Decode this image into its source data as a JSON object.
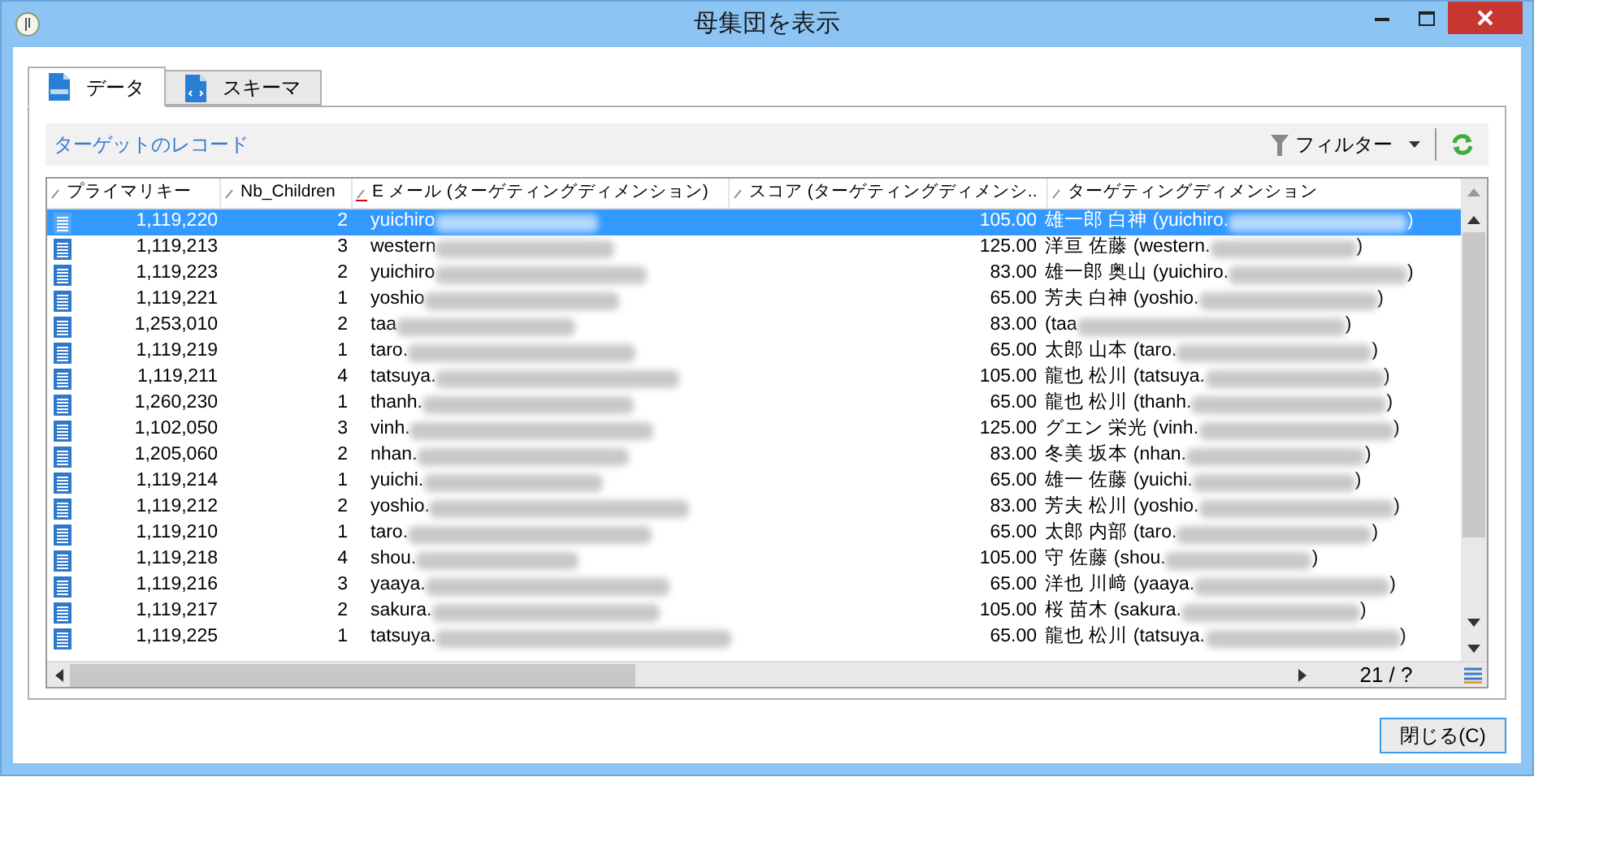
{
  "window": {
    "title": "母集団を表示"
  },
  "tabs": [
    {
      "label": "データ",
      "selected": true,
      "kind": "sql"
    },
    {
      "label": "スキーマ",
      "selected": false,
      "kind": "schema"
    }
  ],
  "toolbar": {
    "title": "ターゲットのレコード",
    "filter": "フィルター"
  },
  "table": {
    "columns": [
      {
        "label": "プライマリキー",
        "sorted": false
      },
      {
        "label": "Nb_Children",
        "sorted": false
      },
      {
        "label": "E メール (ターゲティングディメンション)",
        "sorted": true
      },
      {
        "label": "スコア (ターゲティングディメンシ..",
        "sorted": false
      },
      {
        "label": "ターゲティングディメンション",
        "sorted": false
      }
    ],
    "rows": [
      {
        "selected": true,
        "key": "1,119,220",
        "children": "2",
        "email": "yuichiro",
        "score": "105.00",
        "target": "雄一郎 白神 (yuichiro.",
        "close": ")"
      },
      {
        "selected": false,
        "key": "1,119,213",
        "children": "3",
        "email": "western",
        "score": "125.00",
        "target": "洋亘 佐藤 (western.",
        "close": ")"
      },
      {
        "selected": false,
        "key": "1,119,223",
        "children": "2",
        "email": "yuichiro",
        "score": "83.00",
        "target": "雄一郎 奥山 (yuichiro.",
        "close": ")"
      },
      {
        "selected": false,
        "key": "1,119,221",
        "children": "1",
        "email": "yoshio",
        "score": "65.00",
        "target": "芳夫 白神 (yoshio.",
        "close": ")"
      },
      {
        "selected": false,
        "key": "1,253,010",
        "children": "2",
        "email": "taa",
        "score": "83.00",
        "target": "(taa",
        "close": ")"
      },
      {
        "selected": false,
        "key": "1,119,219",
        "children": "1",
        "email": "taro.",
        "score": "65.00",
        "target": "太郎 山本 (taro.",
        "close": ")"
      },
      {
        "selected": false,
        "key": "1,119,211",
        "children": "4",
        "email": "tatsuya.",
        "score": "105.00",
        "target": "龍也 松川 (tatsuya.",
        "close": ")"
      },
      {
        "selected": false,
        "key": "1,260,230",
        "children": "1",
        "email": "thanh.",
        "score": "65.00",
        "target": "龍也 松川 (thanh.",
        "close": ")"
      },
      {
        "selected": false,
        "key": "1,102,050",
        "children": "3",
        "email": "vinh.",
        "score": "125.00",
        "target": "グエン 栄光 (vinh.",
        "close": ")"
      },
      {
        "selected": false,
        "key": "1,205,060",
        "children": "2",
        "email": "nhan.",
        "score": "83.00",
        "target": "冬美 坂本 (nhan.",
        "close": ")"
      },
      {
        "selected": false,
        "key": "1,119,214",
        "children": "1",
        "email": "yuichi.",
        "score": "65.00",
        "target": "雄一 佐藤 (yuichi.",
        "close": ")"
      },
      {
        "selected": false,
        "key": "1,119,212",
        "children": "2",
        "email": "yoshio.",
        "score": "83.00",
        "target": "芳夫 松川 (yoshio.",
        "close": ")"
      },
      {
        "selected": false,
        "key": "1,119,210",
        "children": "1",
        "email": "taro.",
        "score": "65.00",
        "target": "太郎 内部 (taro.",
        "close": ")"
      },
      {
        "selected": false,
        "key": "1,119,218",
        "children": "4",
        "email": "shou.",
        "score": "105.00",
        "target": "守 佐藤 (shou.",
        "close": ")"
      },
      {
        "selected": false,
        "key": "1,119,216",
        "children": "3",
        "email": "yaaya.",
        "score": "65.00",
        "target": "洋也 川﨑 (yaaya.",
        "close": ")"
      },
      {
        "selected": false,
        "key": "1,119,217",
        "children": "2",
        "email": "sakura.",
        "score": "105.00",
        "target": "桜 苗木 (sakura.",
        "close": ")"
      },
      {
        "selected": false,
        "key": "1,119,225",
        "children": "1",
        "email": "tatsuya.",
        "score": "65.00",
        "target": "龍也 松川 (tatsuya.",
        "close": ")"
      }
    ]
  },
  "pager": "21 / ?",
  "buttons": [
    {
      "label": "閉じる(C)"
    }
  ]
}
